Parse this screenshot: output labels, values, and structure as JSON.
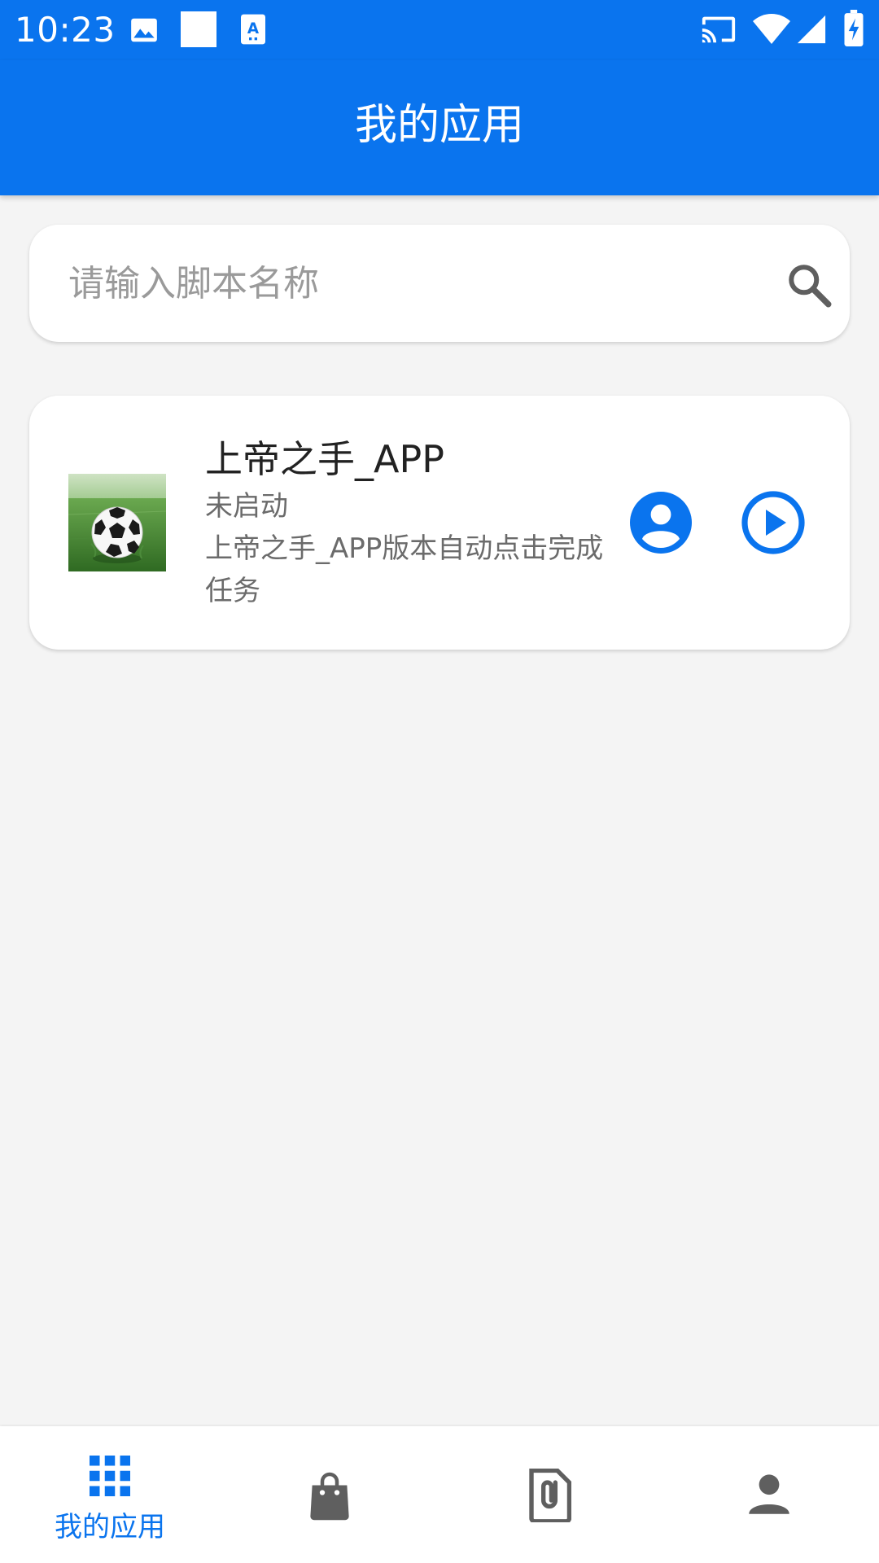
{
  "status_bar": {
    "time": "10:23",
    "left_icons": [
      "image-icon",
      "blank-square-icon",
      "translate-icon"
    ],
    "right_icons": [
      "cast-icon",
      "wifi-icon",
      "signal-icon",
      "battery-charging-icon"
    ]
  },
  "app_bar": {
    "title": "我的应用"
  },
  "search": {
    "placeholder": "请输入脚本名称",
    "value": "",
    "icon": "search-icon"
  },
  "apps": [
    {
      "name": "上帝之手_APP",
      "status": "未启动",
      "description": "上帝之手_APP版本自动点击完成任务",
      "thumbnail": "soccer-ball-image",
      "actions": [
        "user-icon",
        "play-icon"
      ]
    }
  ],
  "bottom_nav": {
    "items": [
      {
        "icon": "grid-icon",
        "label": "我的应用",
        "selected": true
      },
      {
        "icon": "shopping-bag-icon",
        "label": "",
        "selected": false
      },
      {
        "icon": "attachment-file-icon",
        "label": "",
        "selected": false
      },
      {
        "icon": "person-icon",
        "label": "",
        "selected": false
      }
    ]
  },
  "colors": {
    "primary": "#0a74ee",
    "background": "#f4f4f4",
    "card": "#ffffff",
    "text_primary": "#222222",
    "text_secondary": "#6b6b6b",
    "placeholder": "#9a9a9a",
    "icon_inactive": "#5f5f5f"
  }
}
